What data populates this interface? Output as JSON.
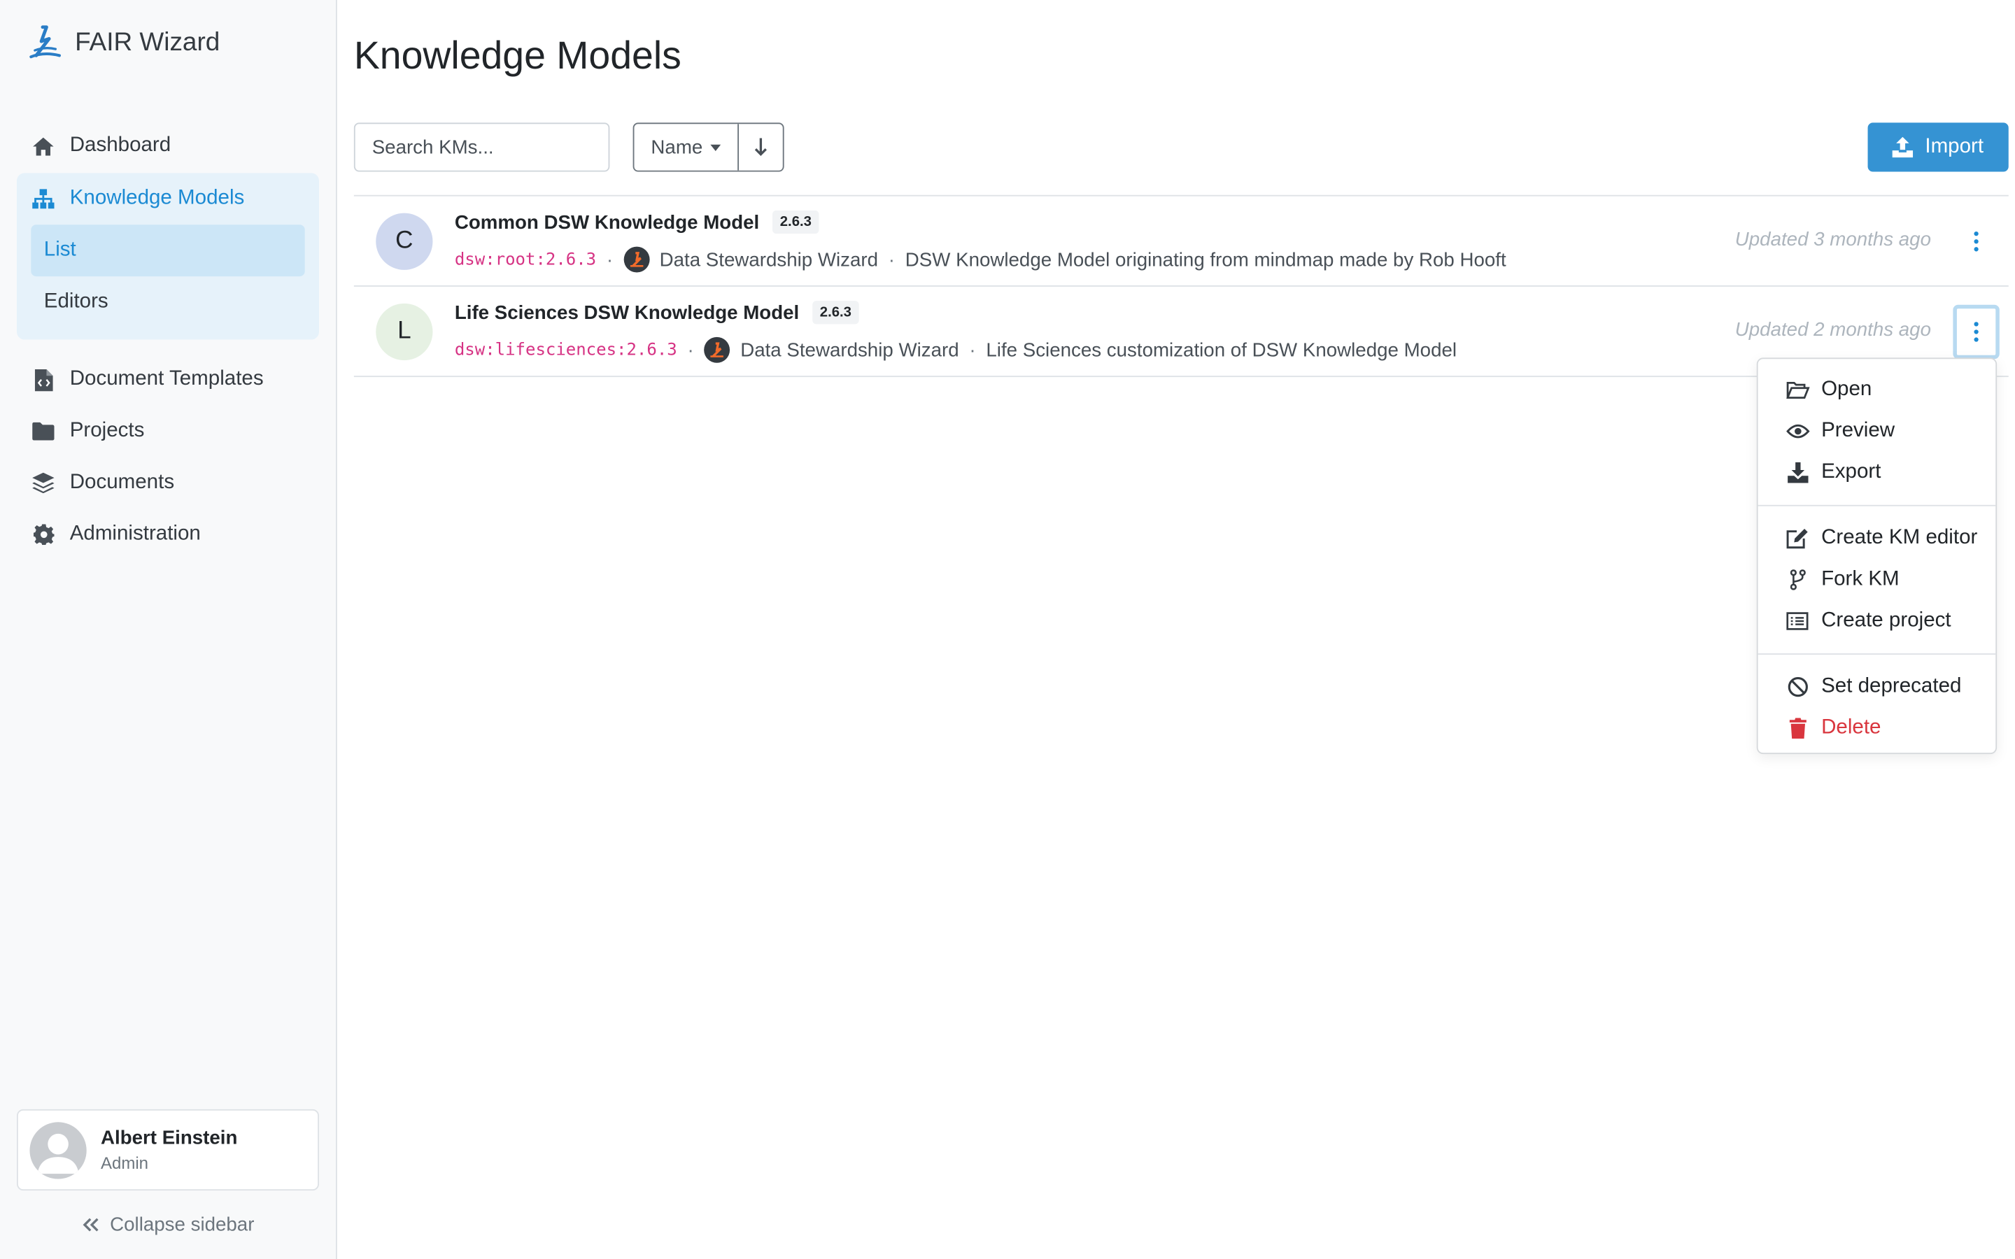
{
  "app": {
    "name": "FAIR Wizard"
  },
  "sidebar": {
    "items": [
      {
        "label": "Dashboard",
        "icon": "home-icon"
      },
      {
        "label": "Knowledge Models",
        "icon": "sitemap-icon",
        "active": true
      },
      {
        "label": "Document Templates",
        "icon": "file-code-icon"
      },
      {
        "label": "Projects",
        "icon": "folder-icon"
      },
      {
        "label": "Documents",
        "icon": "layers-icon"
      },
      {
        "label": "Administration",
        "icon": "gear-icon"
      }
    ],
    "subitems": [
      {
        "label": "List",
        "active": true
      },
      {
        "label": "Editors"
      }
    ],
    "user": {
      "name": "Albert Einstein",
      "role": "Admin"
    },
    "collapse_label": "Collapse sidebar"
  },
  "page": {
    "title": "Knowledge Models",
    "search_placeholder": "Search KMs...",
    "sort_label": "Name",
    "sort_direction_icon": "arrow-down-icon",
    "import_label": "Import"
  },
  "knowledge_models": [
    {
      "initial": "C",
      "name": "Common DSW Knowledge Model",
      "version": "2.6.3",
      "id": "dsw:root:2.6.3",
      "organization": "Data Stewardship Wizard",
      "description": "DSW Knowledge Model originating from mindmap made by Rob Hooft",
      "updated": "Updated 3 months ago",
      "avatar_color": "#cfd8ef"
    },
    {
      "initial": "L",
      "name": "Life Sciences DSW Knowledge Model",
      "version": "2.6.3",
      "id": "dsw:lifesciences:2.6.3",
      "organization": "Data Stewardship Wizard",
      "description": "Life Sciences customization of DSW Knowledge Model",
      "updated": "Updated 2 months ago",
      "avatar_color": "#e6f1e3"
    }
  ],
  "dropdown": {
    "items": [
      {
        "label": "Open",
        "icon": "folder-open-icon"
      },
      {
        "label": "Preview",
        "icon": "eye-icon"
      },
      {
        "label": "Export",
        "icon": "download-icon"
      },
      {
        "label": "Create KM editor",
        "icon": "edit-icon"
      },
      {
        "label": "Fork KM",
        "icon": "code-branch-icon"
      },
      {
        "label": "Create project",
        "icon": "list-icon"
      },
      {
        "label": "Set deprecated",
        "icon": "ban-icon"
      },
      {
        "label": "Delete",
        "icon": "trash-icon",
        "color": "#d9363e"
      }
    ]
  },
  "colors": {
    "accent": "#1b8ad3",
    "import_button": "#3593d3",
    "danger": "#d9363e",
    "code": "#d63384"
  }
}
